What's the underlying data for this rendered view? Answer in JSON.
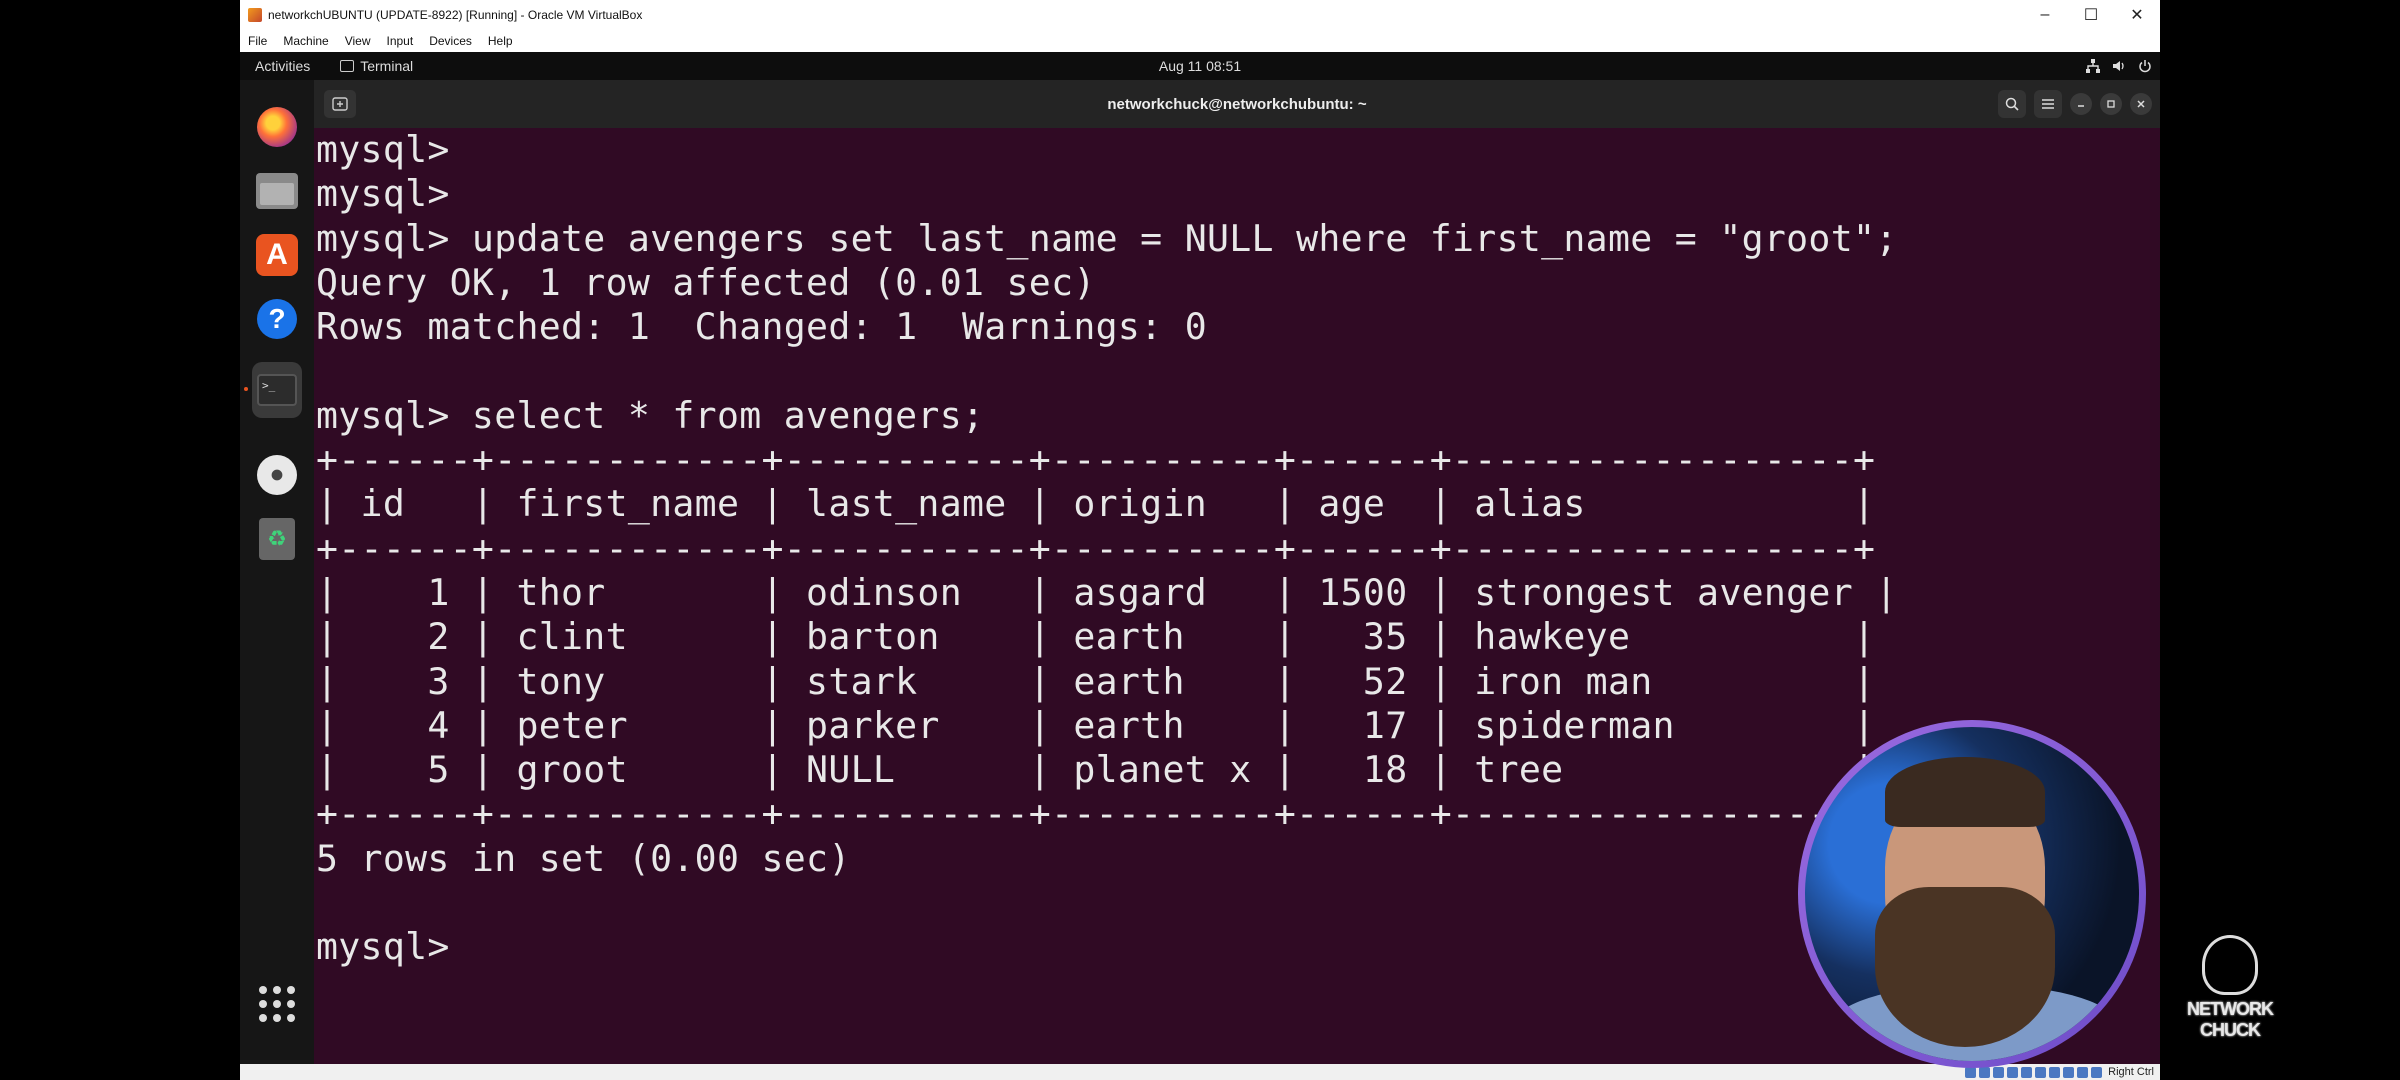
{
  "host": {
    "title": "networkchUBUNTU (UPDATE-8922) [Running] - Oracle VM VirtualBox",
    "menu": [
      "File",
      "Machine",
      "View",
      "Input",
      "Devices",
      "Help"
    ],
    "controls": {
      "minimize": "–",
      "maximize": "☐",
      "close": "✕"
    },
    "host_key": "Right Ctrl"
  },
  "topbar": {
    "activities": "Activities",
    "app": "Terminal",
    "clock": "Aug 11  08:51"
  },
  "dock": {
    "items": [
      "firefox-icon",
      "files-icon",
      "app-center-icon",
      "help-icon",
      "terminal-icon",
      "disc-icon",
      "trash-icon",
      "show-apps-icon"
    ]
  },
  "terminal": {
    "title": "networkchuck@networkchubuntu: ~",
    "lines": [
      "mysql>",
      "mysql>",
      "mysql> update avengers set last_name = NULL where first_name = \"groot\";",
      "Query OK, 1 row affected (0.01 sec)",
      "Rows matched: 1  Changed: 1  Warnings: 0",
      "",
      "mysql> select * from avengers;",
      "+------+------------+-----------+----------+------+------------------+",
      "| id   | first_name | last_name | origin   | age  | alias            |",
      "+------+------------+-----------+----------+------+------------------+",
      "|    1 | thor       | odinson   | asgard   | 1500 | strongest avenger |",
      "|    2 | clint      | barton    | earth    |   35 | hawkeye          |",
      "|    3 | tony       | stark     | earth    |   52 | iron man         |",
      "|    4 | peter      | parker    | earth    |   17 | spiderman        |",
      "|    5 | groot      | NULL      | planet x |   18 | tree             |",
      "+------+------------+-----------+----------+------+------------------+",
      "5 rows in set (0.00 sec)",
      "",
      "mysql>"
    ]
  },
  "overlay": {
    "logo_line1": "NETWORK",
    "logo_line2": "CHUCK"
  }
}
